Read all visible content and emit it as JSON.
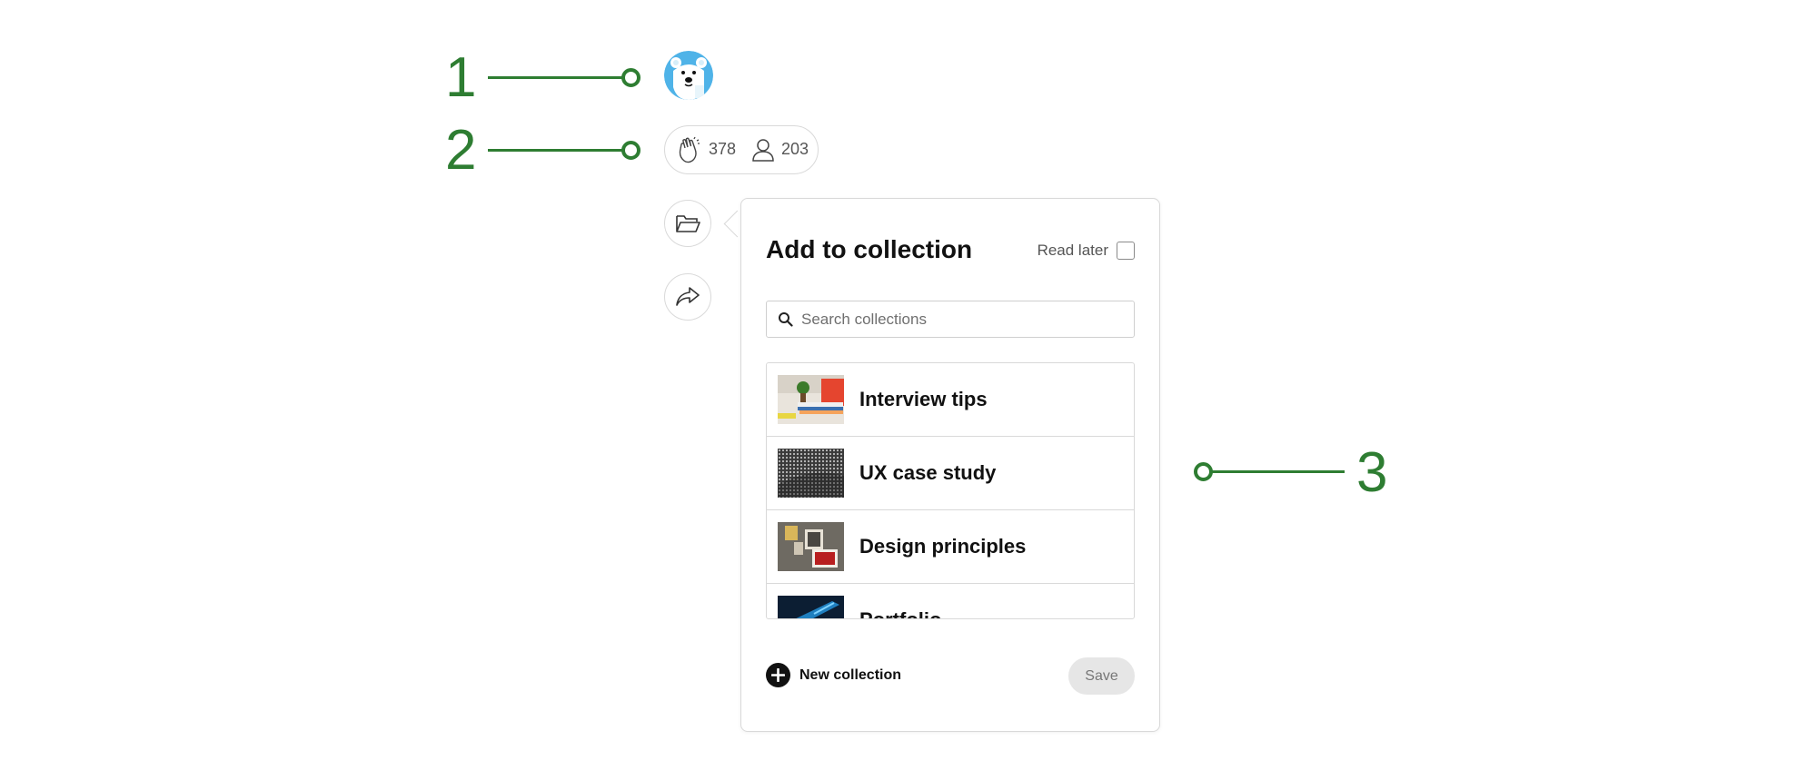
{
  "annotations": [
    "1",
    "2",
    "3"
  ],
  "stats": {
    "claps": "378",
    "followers": "203"
  },
  "popover": {
    "title": "Add to collection",
    "read_later_label": "Read later",
    "search_placeholder": "Search collections",
    "collections": [
      {
        "label": "Interview tips",
        "thumbnail": "desk-books-photo"
      },
      {
        "label": "UX case study",
        "thumbnail": "perforated-metal-photo"
      },
      {
        "label": "Design principles",
        "thumbnail": "wall-shelves-photo"
      },
      {
        "label": "Portfolio",
        "thumbnail": "blue-screen-photo"
      }
    ],
    "new_collection_label": "New collection",
    "save_label": "Save"
  },
  "colors": {
    "annotation": "#2e7d32",
    "avatar_bg": "#4fb3e8"
  }
}
